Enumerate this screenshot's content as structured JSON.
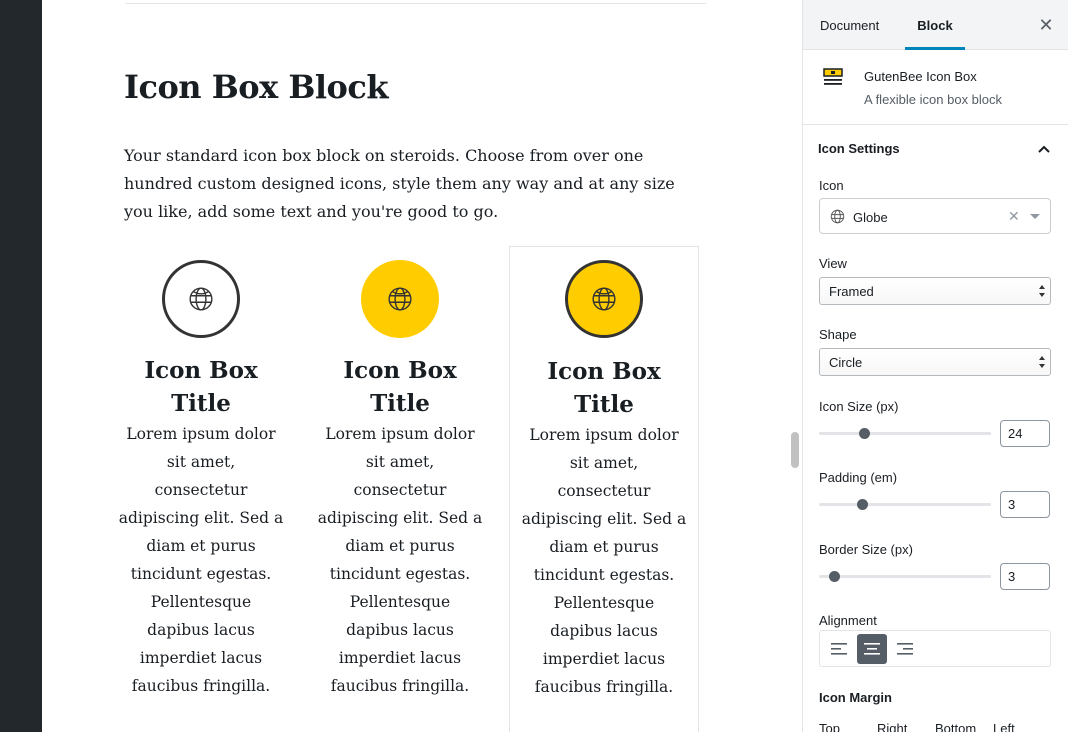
{
  "editor": {
    "title": "Icon Box Block",
    "intro": "Your standard icon box block on steroids. Choose from over one hundred custom designed icons, style them any way and at any size you like, add some text and you're good to go.",
    "boxes": [
      {
        "title_line1": "Icon Box",
        "title_line2": "Title",
        "text": "Lorem ipsum dolor sit amet, consectetur adipiscing elit. Sed a diam et purus tincidunt egestas. Pellentesque dapibus lacus imperdiet lacus faucibus fringilla.",
        "style": "framed"
      },
      {
        "title_line1": "Icon Box",
        "title_line2": "Title",
        "text": "Lorem ipsum dolor sit amet, consectetur adipiscing elit. Sed a diam et purus tincidunt egestas. Pellentesque dapibus lacus imperdiet lacus faucibus fringilla.",
        "style": "filled"
      },
      {
        "title_line1": "Icon Box",
        "title_line2": "Title",
        "text": "Lorem ipsum dolor sit amet, consectetur adipiscing elit. Sed a diam et purus tincidunt egestas. Pellentesque dapibus lacus imperdiet lacus faucibus fringilla.",
        "style": "filled-framed"
      }
    ]
  },
  "sidebar": {
    "tabs": [
      "Document",
      "Block"
    ],
    "active_tab": "Block",
    "close_icon": "close-icon",
    "block_card": {
      "name": "GutenBee Icon Box",
      "description": "A flexible icon box block",
      "icon": "icon-box-block-icon"
    },
    "panel": {
      "title": "Icon Settings",
      "icon_label": "Icon",
      "icon_value": "Globe",
      "view_label": "View",
      "view_value": "Framed",
      "shape_label": "Shape",
      "shape_value": "Circle",
      "icon_size_label": "Icon Size (px)",
      "icon_size_value": "24",
      "padding_label": "Padding (em)",
      "padding_value": "3",
      "border_size_label": "Border Size (px)",
      "border_size_value": "3",
      "alignment_label": "Alignment",
      "alignment_active": "center",
      "margin_title": "Icon Margin",
      "margin_labels": [
        "Top",
        "Right",
        "Bottom",
        "Left"
      ]
    }
  },
  "colors": {
    "accent_yellow": "#ffcc00",
    "tab_underline": "#0085ba",
    "dark": "#23282d"
  }
}
